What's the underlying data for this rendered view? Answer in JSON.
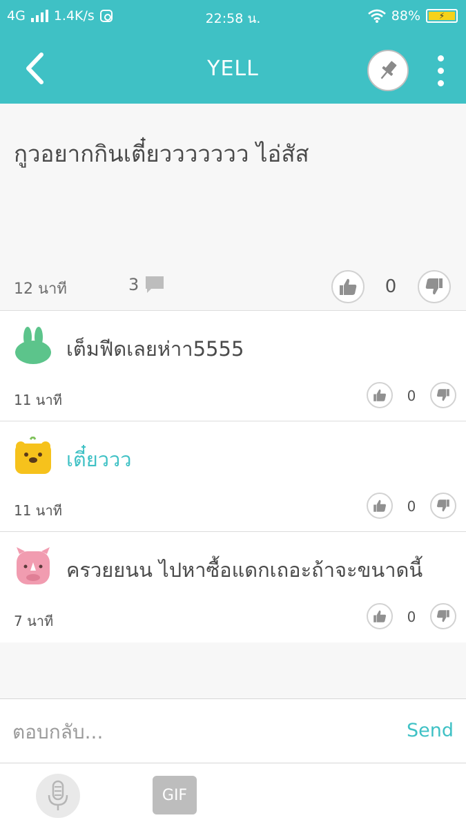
{
  "status_bar": {
    "network": "4G",
    "speed": "1.4K/s",
    "time": "22:58 น.",
    "battery": "88%"
  },
  "app_bar": {
    "title": "YELL"
  },
  "post": {
    "text": "กูวอยากกินเตี๋ยววววววว ไอ่สัส",
    "time": "12 นาที",
    "comment_count": "3",
    "vote_count": "0"
  },
  "replies": [
    {
      "text": "เต็มฟีดเลยห่าา5555",
      "time": "11 นาที",
      "votes": "0",
      "avatar": "green-rabbit-icon"
    },
    {
      "text": "เตี๋ยววว",
      "time": "11 นาที",
      "votes": "0",
      "avatar": "yellow-bear-icon"
    },
    {
      "text": "ครวยยนน ไปหาซื้อแดกเถอะถ้าจะขนาดนี้",
      "time": "7 นาที",
      "votes": "0",
      "avatar": "pink-rhino-icon"
    }
  ],
  "reply_bar": {
    "placeholder": "ตอบกลับ...",
    "send_label": "Send"
  },
  "toolbar": {
    "gif_label": "GIF"
  },
  "colors": {
    "accent": "#3fc1c5",
    "battery": "#f6d21a"
  }
}
